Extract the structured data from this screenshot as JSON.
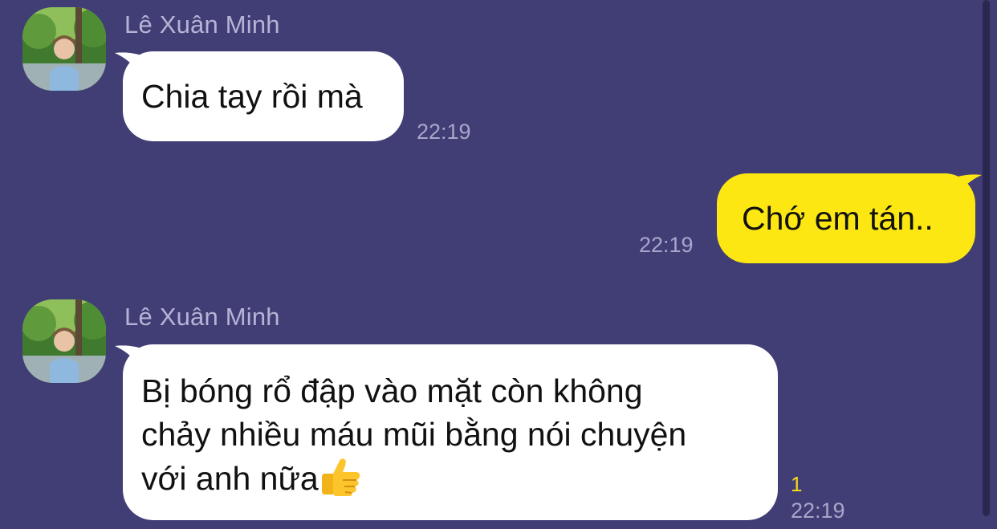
{
  "chat": {
    "messages": [
      {
        "direction": "incoming",
        "sender": "Lê Xuân Minh",
        "avatar_icon": "profile-photo-avatar",
        "text": "Chia tay rồi mà",
        "time": "22:19"
      },
      {
        "direction": "outgoing",
        "text": "Chớ em tán..",
        "time": "22:19"
      },
      {
        "direction": "incoming",
        "sender": "Lê Xuân Minh",
        "avatar_icon": "profile-photo-avatar",
        "text_lines": [
          "Bị bóng rổ đập vào mặt còn không",
          "chảy nhiều máu mũi bằng nói chuyện",
          "với anh nữa"
        ],
        "emoji_icon": "thumbs-up-emoji",
        "time": "22:19",
        "unread_count": "1"
      }
    ]
  },
  "colors": {
    "background": "#413e76",
    "incoming_bubble": "#ffffff",
    "outgoing_bubble": "#fde712",
    "meta_text": "#a9a6cb",
    "unread_count": "#f4d81c"
  }
}
